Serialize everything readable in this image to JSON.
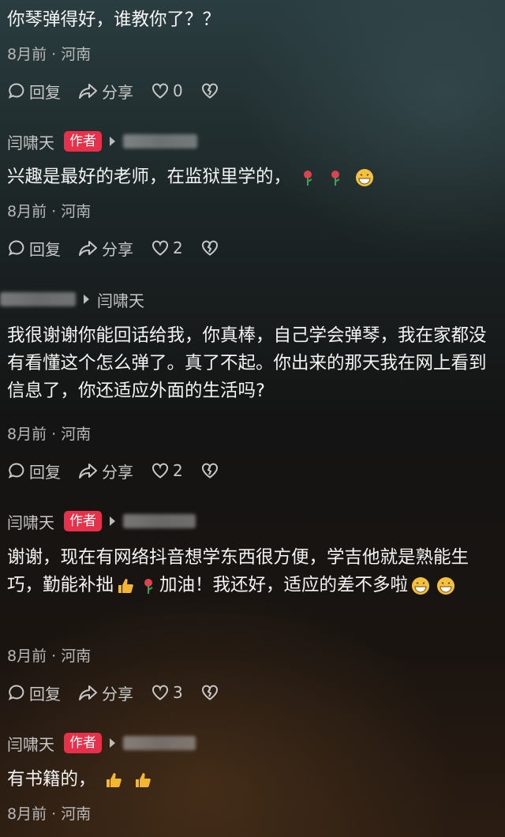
{
  "comments": [
    {
      "text": "你琴弹得好，谁教你了？？",
      "meta": "8月前 · 河南",
      "reply": "回复",
      "share": "分享",
      "likes": "0"
    },
    {
      "author": "闫啸天",
      "badge": "作者",
      "text": "兴趣是最好的老师，在监狱里学的，",
      "meta": "8月前 · 河南",
      "reply": "回复",
      "share": "分享",
      "likes": "2"
    },
    {
      "reply_to": "闫啸天",
      "text": "我很谢谢你能回话给我，你真棒，自己学会弹琴，我在家都没有看懂这个怎么弹了。真了不起。你出来的那天我在网上看到信息了，你还适应外面的生活吗?",
      "meta": "8月前 · 河南",
      "reply": "回复",
      "share": "分享",
      "likes": "2"
    },
    {
      "author": "闫啸天",
      "badge": "作者",
      "text_a": "谢谢，现在有网络抖音想学东西很方便，学吉他就是熟能生巧，勤能补拙",
      "text_b": "加油！我还好，适应的差不多啦",
      "meta": "8月前 · 河南",
      "reply": "回复",
      "share": "分享",
      "likes": "3"
    },
    {
      "author": "闫啸天",
      "badge": "作者",
      "text": "有书籍的，",
      "meta": "8月前 · 河南"
    }
  ],
  "icons": [
    "comment-icon",
    "share-icon",
    "heart-icon",
    "broken-heart-icon",
    "rose-emoji",
    "grin-emoji",
    "thumbs-up-emoji"
  ],
  "colors": {
    "badge": "#e8304a",
    "text": "#f4f4f4",
    "meta": "#b8b8b8"
  }
}
